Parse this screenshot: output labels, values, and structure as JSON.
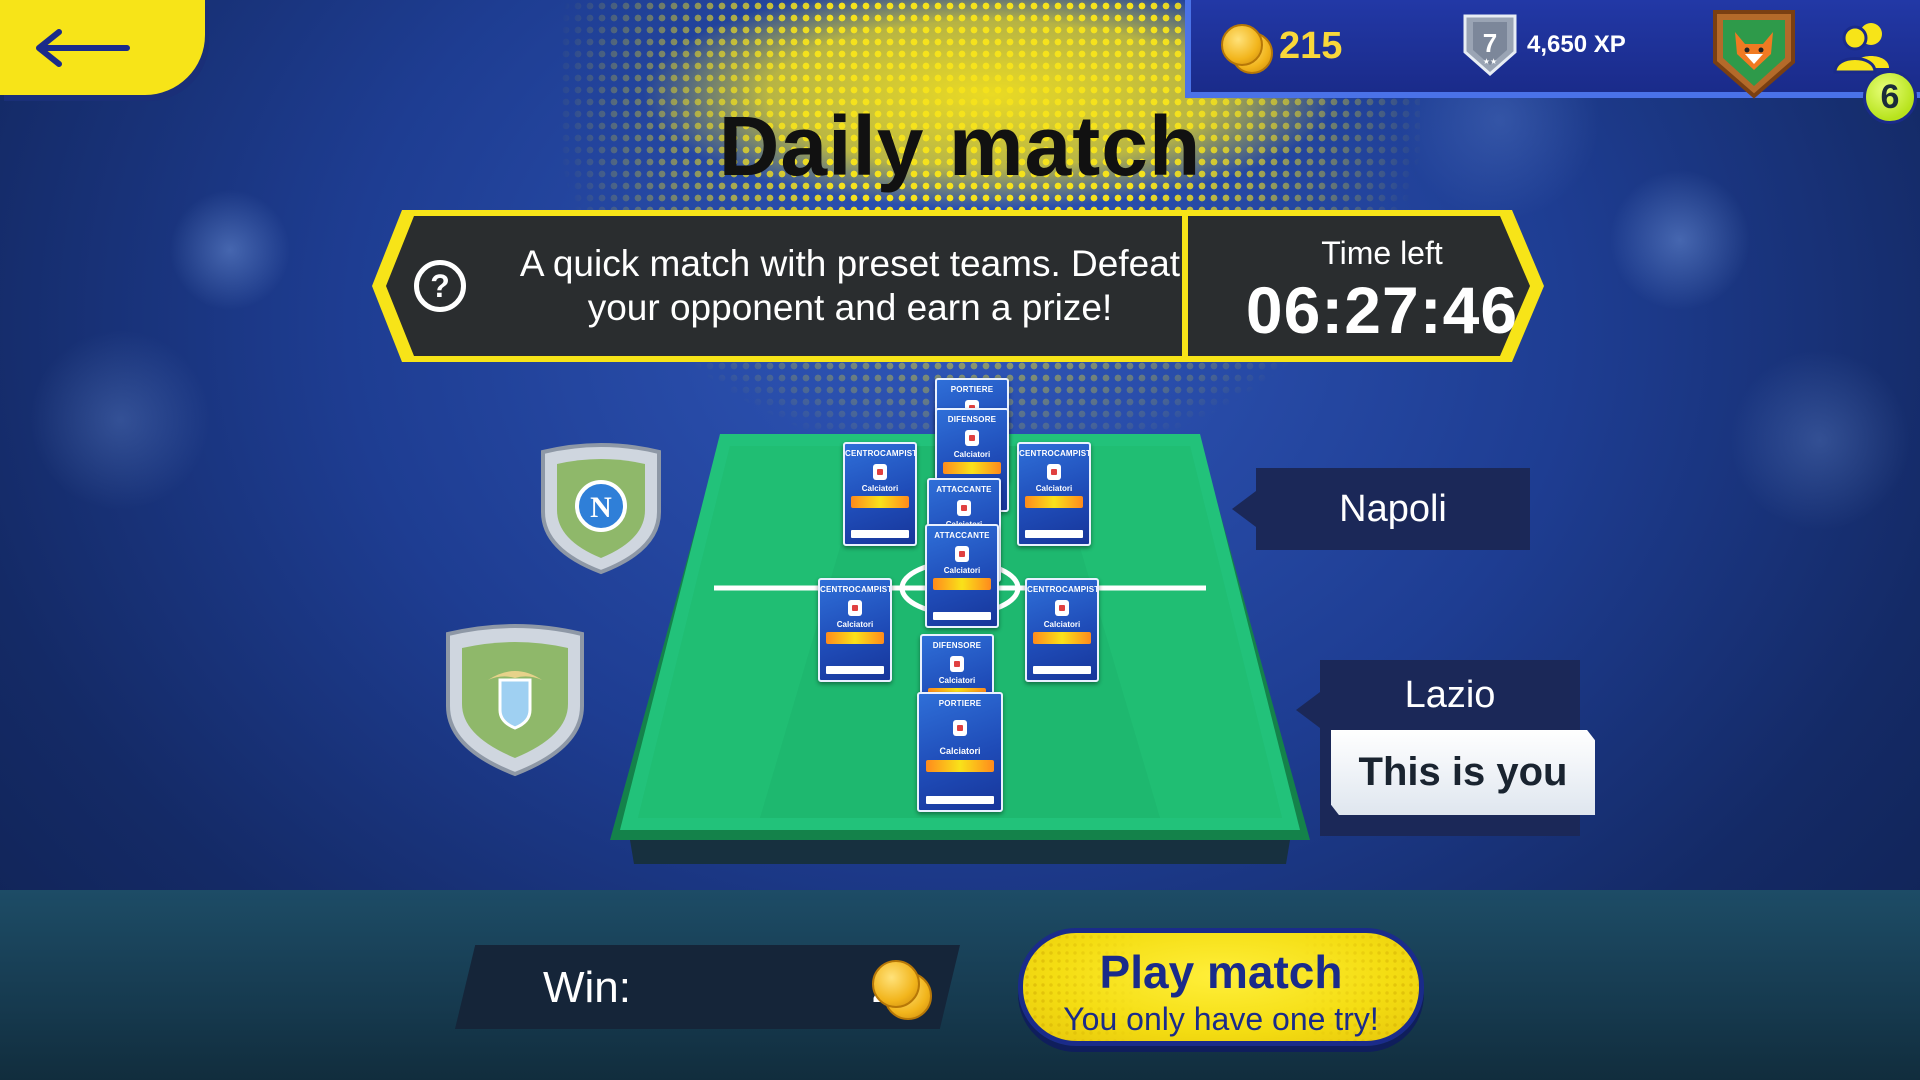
{
  "header": {
    "title": "Daily match",
    "coins": "215",
    "rank_level": "7",
    "xp": "4,650 XP",
    "friends_count": "6"
  },
  "banner": {
    "description": "A quick match with preset teams. Defeat your opponent and earn a prize!",
    "time_left_label": "Time left",
    "time_left_value": "06:27:46"
  },
  "teams": {
    "opponent": {
      "name": "Napoli",
      "crest_letter": "N"
    },
    "player": {
      "name": "Lazio",
      "tag": "This is you"
    }
  },
  "cards": [
    {
      "role": "PORTIERE"
    },
    {
      "role": "DIFENSORE"
    },
    {
      "role": "CENTROCAMPISTA"
    },
    {
      "role": "ATTACCANTE"
    },
    {
      "role": "ATTACCANTE"
    },
    {
      "role": "CENTROCAMPISTA"
    },
    {
      "role": "CENTROCAMPISTA"
    },
    {
      "role": "CENTROCAMPISTA"
    },
    {
      "role": "DIFENSORE"
    },
    {
      "role": "PORTIERE"
    }
  ],
  "card_brand": "Calciatori",
  "reward": {
    "label": "Win:",
    "amount": "20"
  },
  "play_button": {
    "title": "Play match",
    "subtitle": "You only have one try!"
  },
  "colors": {
    "accent_yellow": "#f7e418",
    "navy": "#1a2b8a",
    "pitch_green": "#22c27a",
    "panel_dark": "#2a2d2f"
  }
}
